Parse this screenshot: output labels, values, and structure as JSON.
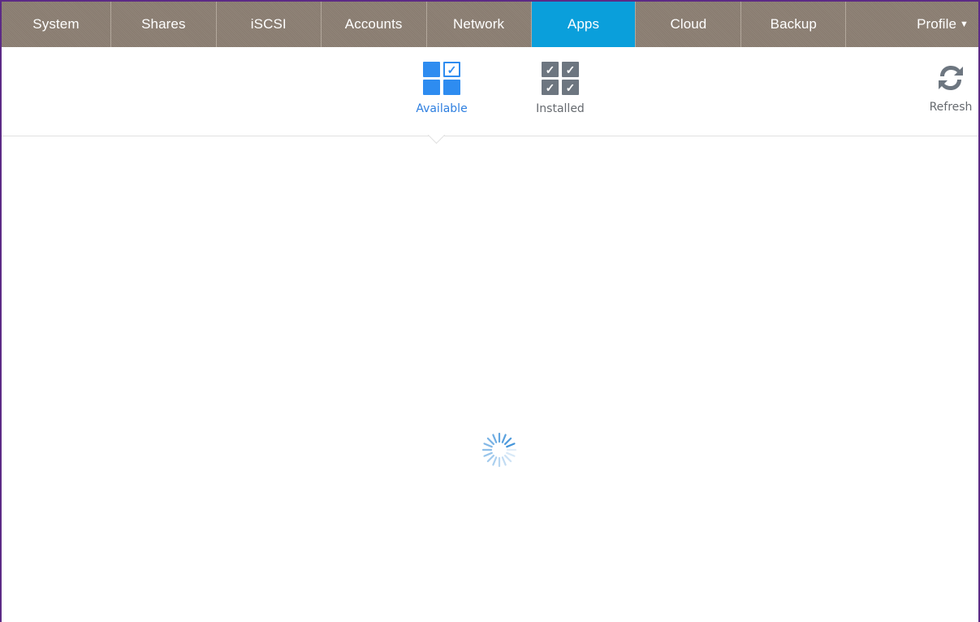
{
  "nav": {
    "tabs": [
      {
        "label": "System",
        "active": false
      },
      {
        "label": "Shares",
        "active": false
      },
      {
        "label": "iSCSI",
        "active": false
      },
      {
        "label": "Accounts",
        "active": false
      },
      {
        "label": "Network",
        "active": false
      },
      {
        "label": "Apps",
        "active": true
      },
      {
        "label": "Cloud",
        "active": false
      },
      {
        "label": "Backup",
        "active": false
      }
    ],
    "profile_label": "Profile",
    "profile_caret_icon": "caret-down-icon",
    "background_color": "#8c7f73",
    "active_color": "#0a9fdb"
  },
  "subnav": {
    "available": {
      "label": "Available",
      "icon": "grid-available-icon",
      "active": true,
      "color": "#2e7fe0"
    },
    "installed": {
      "label": "Installed",
      "icon": "grid-installed-icon",
      "active": false
    },
    "refresh": {
      "label": "Refresh",
      "icon": "refresh-icon"
    }
  },
  "main": {
    "loading": true,
    "spinner_icon": "loading-spinner-icon"
  }
}
